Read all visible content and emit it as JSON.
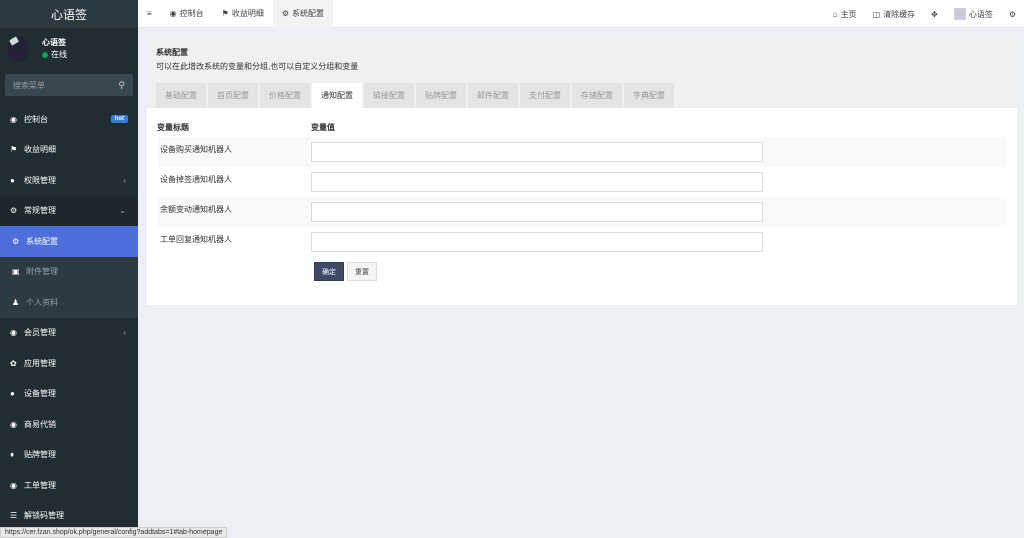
{
  "brand": "心语签",
  "user": {
    "name": "心语签",
    "status": "在线"
  },
  "search": {
    "placeholder": "搜索菜单"
  },
  "sidebar": {
    "items": [
      {
        "label": "控制台",
        "icon": "dashboard-icon",
        "badge": "hot"
      },
      {
        "label": "收益明细",
        "icon": "flag-icon"
      },
      {
        "label": "权限管理",
        "icon": "group-icon",
        "arrow": "‹"
      },
      {
        "label": "常规管理",
        "icon": "cogs-icon",
        "arrow": "⌄"
      }
    ],
    "sub": [
      {
        "label": "系统配置",
        "icon": "gear-icon"
      },
      {
        "label": "附件管理",
        "icon": "file-image-icon"
      },
      {
        "label": "个人资料",
        "icon": "user-icon"
      }
    ],
    "more": [
      {
        "label": "会员管理",
        "icon": "user-circle-icon",
        "arrow": "‹"
      },
      {
        "label": "应用管理",
        "icon": "leaf-icon"
      },
      {
        "label": "设备管理",
        "icon": "circle-icon"
      },
      {
        "label": "商易代销",
        "icon": "circle-icon"
      },
      {
        "label": "贴牌管理",
        "icon": "tags-icon"
      },
      {
        "label": "工单管理",
        "icon": "dashboard-icon"
      },
      {
        "label": "解锁码管理",
        "icon": "bank-icon"
      }
    ]
  },
  "topbar": {
    "menu_icon": "≡",
    "tabs": [
      {
        "label": "控制台",
        "icon": "dashboard-icon"
      },
      {
        "label": "收益明细",
        "icon": "flag-icon"
      },
      {
        "label": "系统配置",
        "icon": "gear-icon"
      }
    ],
    "right": {
      "home": "主页",
      "clear_cache": "清除缓存",
      "user": "心语签"
    }
  },
  "panel": {
    "title": "系统配置",
    "desc": "可以在此增改系统的变量和分组,也可以自定义分组和变量",
    "tabs": [
      "基础配置",
      "首页配置",
      "价格配置",
      "通知配置",
      "链接配置",
      "贴牌配置",
      "邮件配置",
      "支付配置",
      "存储配置",
      "字典配置"
    ],
    "active_tab": 3,
    "table": {
      "headers": [
        "变量标题",
        "变量值"
      ],
      "rows": [
        {
          "label": "设备购买通知机器人",
          "value": ""
        },
        {
          "label": "设备掉签通知机器人",
          "value": ""
        },
        {
          "label": "余额变动通知机器人",
          "value": ""
        },
        {
          "label": "工单回复通知机器人",
          "value": ""
        }
      ]
    },
    "buttons": {
      "submit": "确定",
      "reset": "重置"
    }
  },
  "statusbar": "https://cer.fzan.shop/ok.php/general/config?addtabs=1#tab-homepage"
}
